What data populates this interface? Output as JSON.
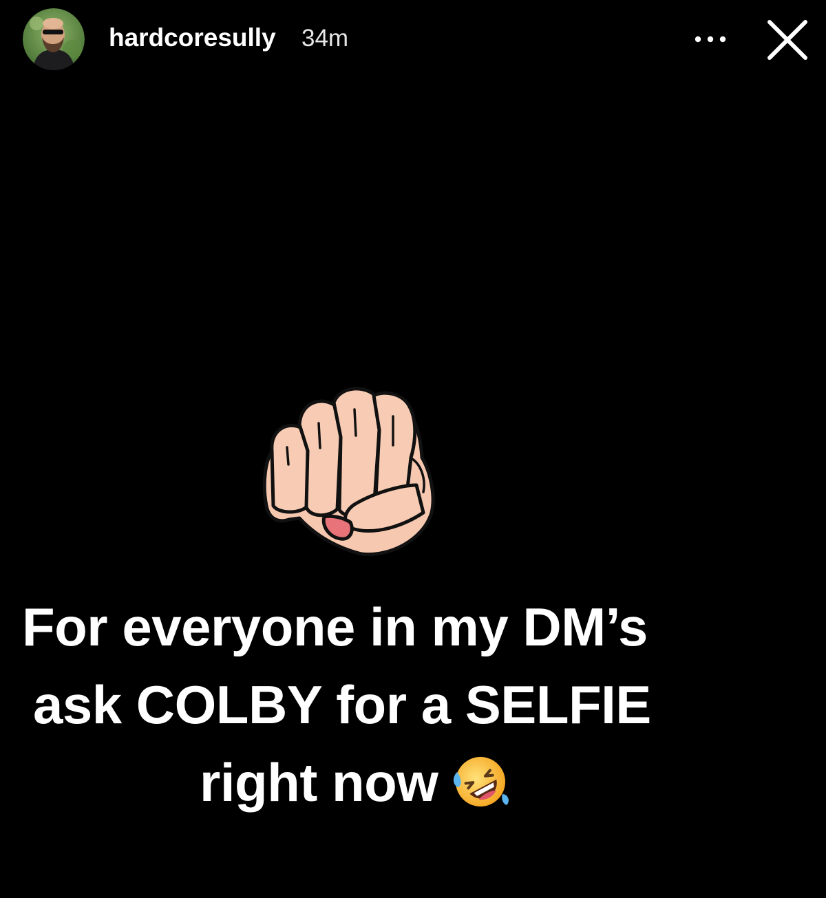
{
  "header": {
    "username": "hardcoresully",
    "time_ago": "34m",
    "avatar_icon": "profile-avatar",
    "more_icon": "more-dots-icon",
    "close_icon": "close-x-icon"
  },
  "content": {
    "sticker_icon": "raised-fist-icon",
    "caption_lines": [
      "For everyone in my DM’s",
      "ask COLBY for a SELFIE",
      "right now"
    ],
    "caption_emoji": "rolling-on-the-floor-laughing-emoji"
  },
  "colors": {
    "background": "#000000",
    "text": "#ffffff",
    "skin": "#f7c8b0",
    "nail": "#e8747a"
  }
}
